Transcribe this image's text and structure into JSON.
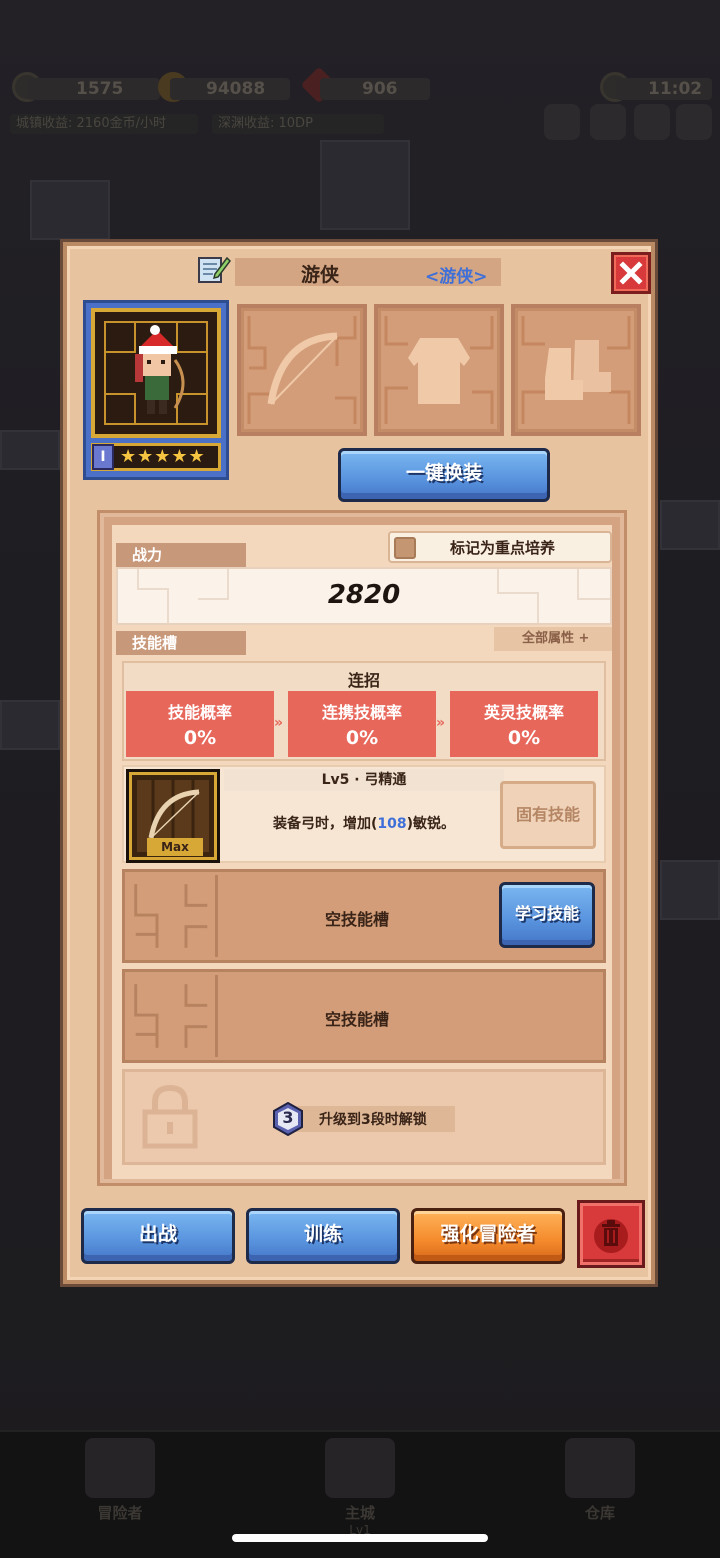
{
  "hud": {
    "stat1": "1575",
    "gold": "94088",
    "gems": "906",
    "time": "11:02",
    "town_income": "城镇收益: 2160金币/小时",
    "abyss_income": "深渊收益: 10DP"
  },
  "dialog": {
    "title": "游侠",
    "class_tag": "<游侠>",
    "equip_all_label": "一键换装",
    "mark_label": "标记为重点培养",
    "power_label": "战力",
    "power_value": "2820",
    "skill_slot_label": "技能槽",
    "all_attributes": "全部属性 +",
    "combo_title": "连招",
    "rates": [
      {
        "name": "技能概率",
        "value": "0%"
      },
      {
        "name": "连携技概率",
        "value": "0%"
      },
      {
        "name": "英灵技概率",
        "value": "0%"
      }
    ],
    "skill": {
      "title": "Lv5 · 弓精通",
      "desc_prefix": "装备弓时，增加(",
      "desc_value": "108",
      "desc_suffix": ")敏锐。",
      "max_label": "Max",
      "fixed_label": "固有技能"
    },
    "empty_slot_label": "空技能槽",
    "learn_skill_label": "学习技能",
    "lock_badge": "3",
    "locked_label": "升级到3段时解锁",
    "level_badge": "I",
    "stars": "★★★★★",
    "actions": {
      "deploy": "出战",
      "train": "训练",
      "enhance": "强化冒险者"
    }
  },
  "nav": [
    {
      "label": "冒险者",
      "sub": ""
    },
    {
      "label": "主城",
      "sub": "Lv1"
    },
    {
      "label": "仓库",
      "sub": ""
    }
  ],
  "colors": {
    "panel": "#e8c39f",
    "accent_blue": "#5b96e0",
    "accent_orange": "#f48a2c",
    "danger_red": "#d8393a",
    "rate_red": "#e8675b"
  }
}
